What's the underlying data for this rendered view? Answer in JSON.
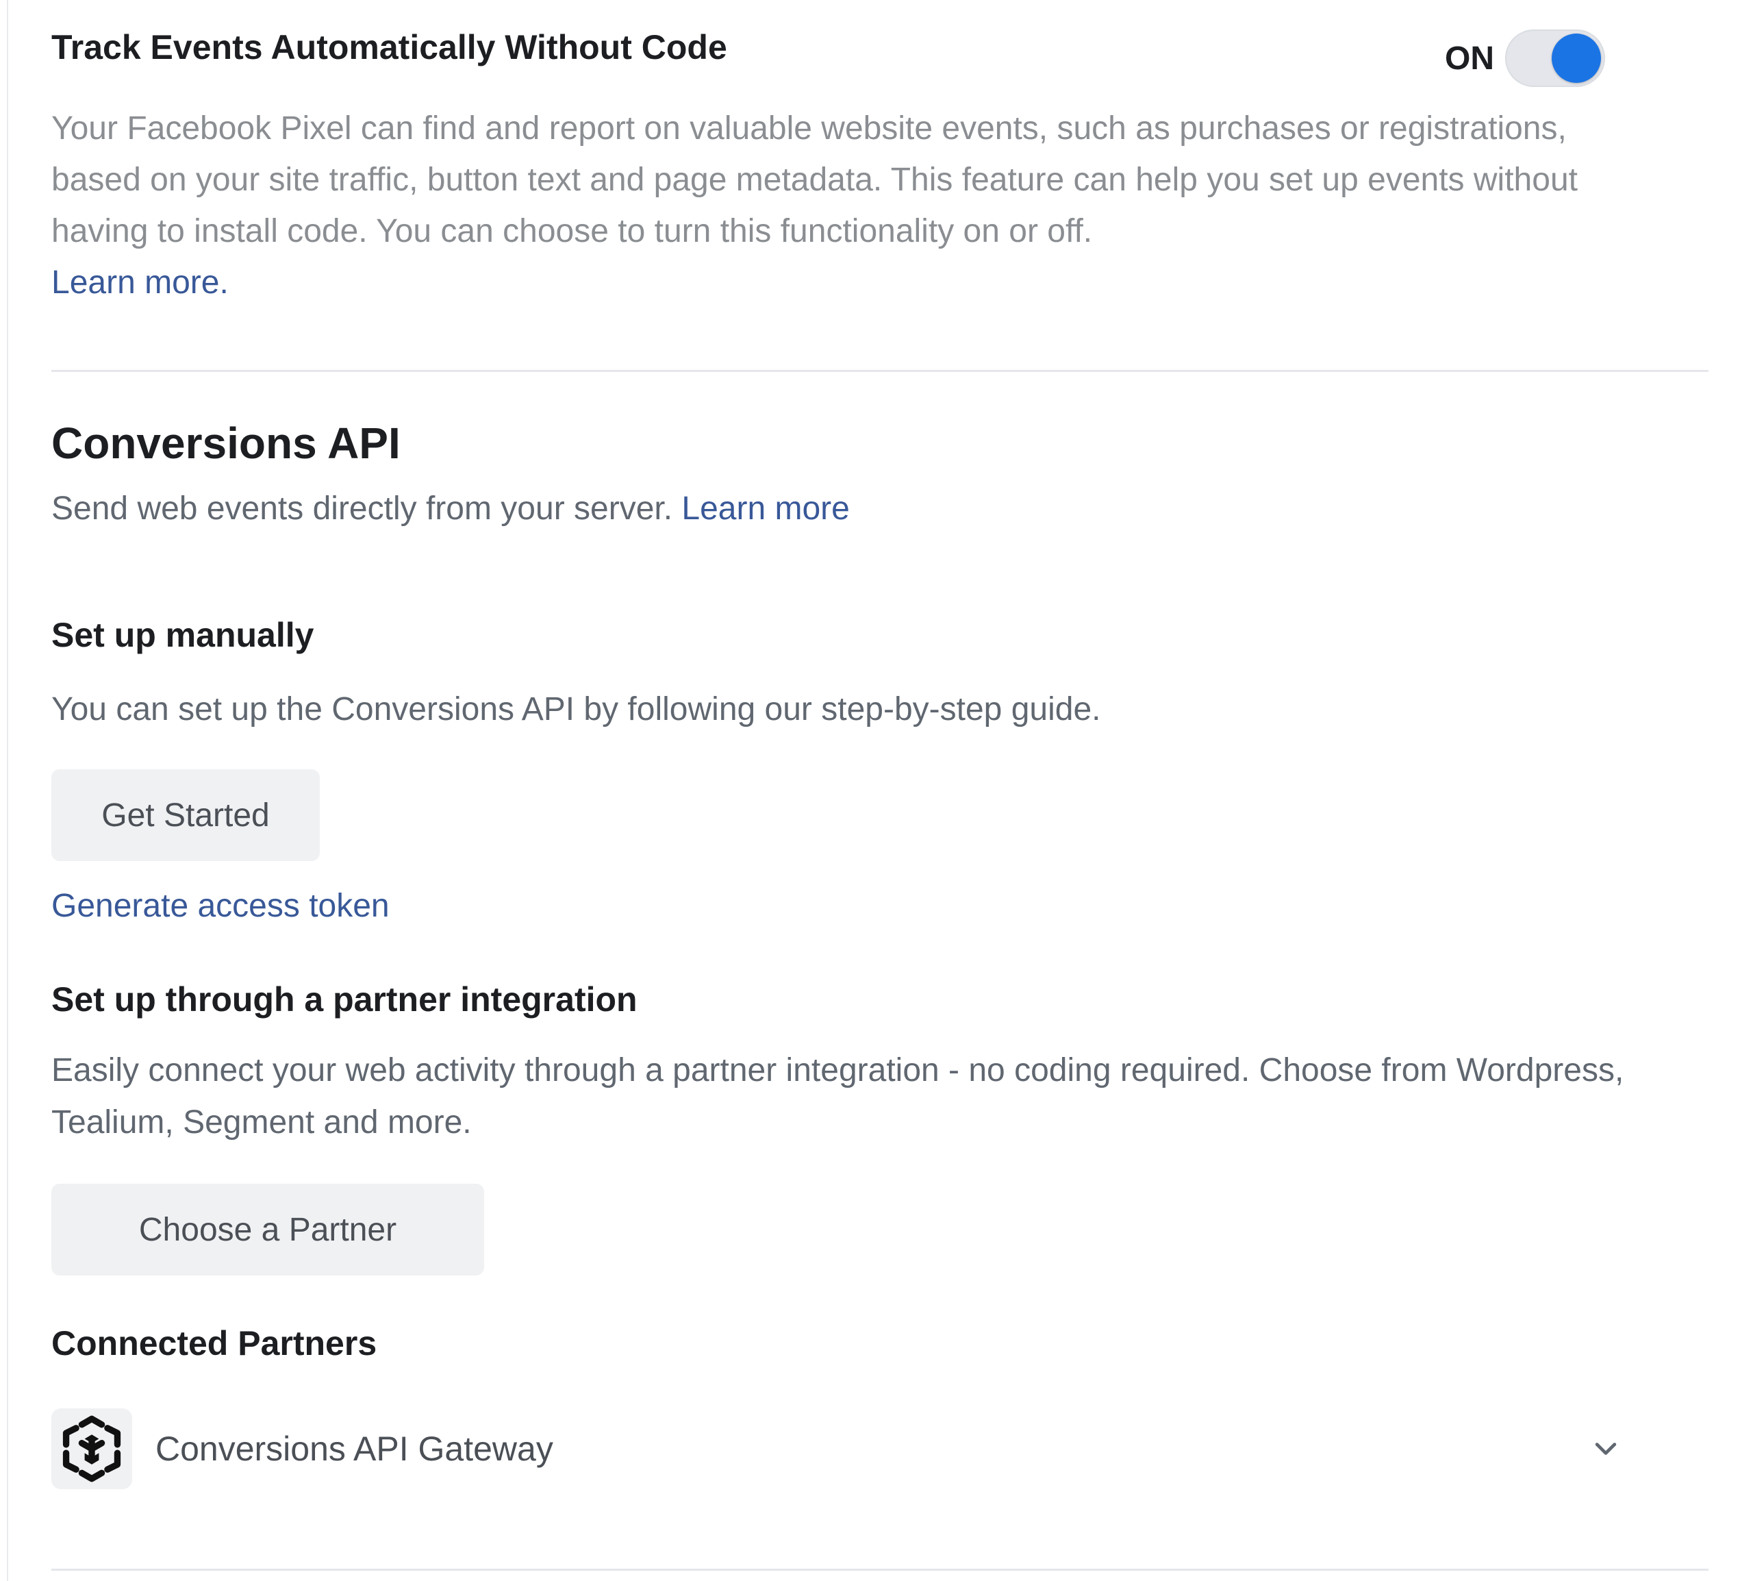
{
  "auto_events": {
    "title": "Track Events Automatically Without Code",
    "toggle_state": "ON",
    "toggle_on": true,
    "description": "Your Facebook Pixel can find and report on valuable website events, such as purchases or registrations, based on your site traffic, button text and page metadata. This feature can help you set up events without having to install code. You can choose to turn this functionality on or off.",
    "learn_more": "Learn more."
  },
  "conversions_api": {
    "title": "Conversions API",
    "description": "Send web events directly from your server.",
    "learn_more": "Learn more",
    "manual": {
      "title": "Set up manually",
      "description": "You can set up the Conversions API by following our step-by-step guide.",
      "button": "Get Started",
      "token_link": "Generate access token"
    },
    "partner": {
      "title": "Set up through a partner integration",
      "description": "Easily connect your web activity through a partner integration - no coding required. Choose from Wordpress, Tealium, Segment and more.",
      "button": "Choose a Partner"
    },
    "connected": {
      "title": "Connected Partners",
      "items": [
        {
          "name": "Conversions API Gateway",
          "icon": "cube-gateway-icon"
        }
      ]
    }
  },
  "colors": {
    "accent": "#1b74e4",
    "link": "#385898",
    "muted_text": "#8a8d91",
    "body_text": "#606770",
    "button_bg": "#f0f1f3"
  }
}
